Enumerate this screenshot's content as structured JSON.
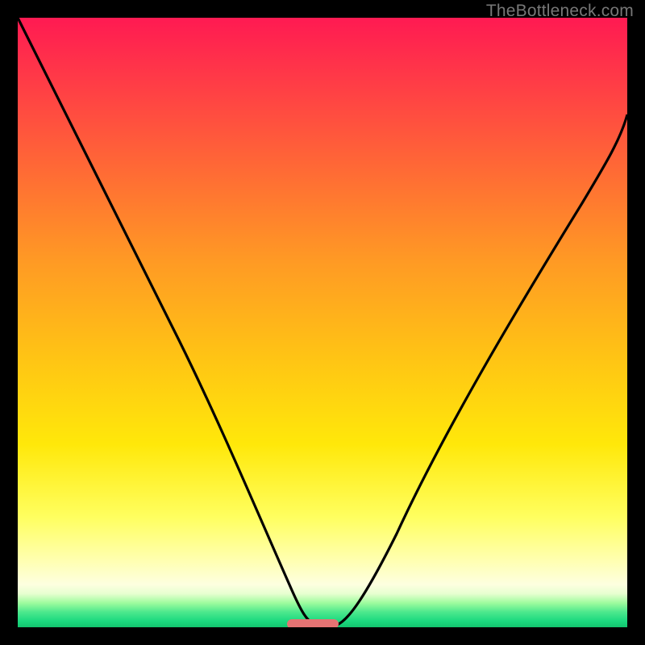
{
  "watermark": {
    "text": "TheBottleneck.com"
  },
  "colors": {
    "frame": "#000000",
    "curve": "#000000",
    "marker": "#e57373",
    "watermark": "#777777",
    "gradient_stops": [
      "#ff1a52",
      "#ff3a47",
      "#ff6a35",
      "#ff9a24",
      "#ffc215",
      "#ffe80a",
      "#ffff60",
      "#ffffb0",
      "#fdffe0",
      "#e7ffd0",
      "#9efc9e",
      "#4de88d",
      "#1bd97f",
      "#13c46e"
    ]
  },
  "chart_data": {
    "type": "line",
    "title": "",
    "xlabel": "",
    "ylabel": "",
    "xlim": [
      0,
      1
    ],
    "ylim": [
      0,
      1
    ],
    "note": "Values estimated from pixel positions; x,y normalized to plot area where y=0 is bottom (green) and y=1 is top (red).",
    "marker": {
      "x_start": 0.44,
      "x_end": 0.53,
      "y": 0.006
    },
    "series": [
      {
        "name": "left-branch",
        "x": [
          0.0,
          0.05,
          0.1,
          0.15,
          0.2,
          0.25,
          0.3,
          0.35,
          0.4,
          0.44,
          0.48
        ],
        "y": [
          1.0,
          0.88,
          0.77,
          0.66,
          0.56,
          0.46,
          0.36,
          0.25,
          0.14,
          0.06,
          0.0
        ]
      },
      {
        "name": "right-branch",
        "x": [
          0.48,
          0.52,
          0.56,
          0.61,
          0.66,
          0.71,
          0.76,
          0.81,
          0.86,
          0.91,
          0.96,
          1.0
        ],
        "y": [
          0.0,
          0.03,
          0.09,
          0.18,
          0.29,
          0.4,
          0.5,
          0.59,
          0.67,
          0.74,
          0.8,
          0.85
        ]
      }
    ]
  }
}
